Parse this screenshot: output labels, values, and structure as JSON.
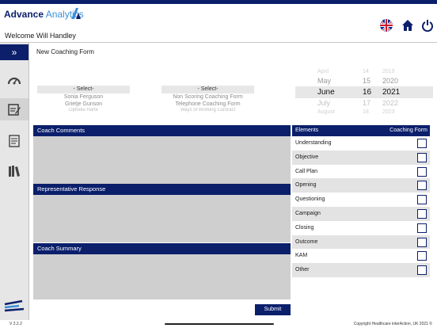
{
  "brand": {
    "name_bold": "Advance",
    "name_light": "Analytics"
  },
  "header": {
    "welcome": "Welcome Will Handley"
  },
  "sidebar": {
    "expand_glyph": "»",
    "items": [
      "dashboard-gauge-icon",
      "coaching-form-icon",
      "notes-icon",
      "library-icon"
    ]
  },
  "form": {
    "title": "New Coaching Form",
    "agent_picker": {
      "selected": "- Select-",
      "options": [
        "Sonia Ferguson",
        "Grietje Gunson",
        "Ophelia Harte"
      ]
    },
    "form_picker": {
      "selected": "- Select-",
      "options": [
        "Non Scoring Coaching Form",
        "Telephone Coaching Form",
        "Ways of Working Contract"
      ]
    },
    "date_picker": {
      "rows": [
        {
          "month": "April",
          "day": "14",
          "year": "2019"
        },
        {
          "month": "May",
          "day": "15",
          "year": "2020"
        },
        {
          "month": "June",
          "day": "16",
          "year": "2021"
        },
        {
          "month": "July",
          "day": "17",
          "year": "2022"
        },
        {
          "month": "August",
          "day": "18",
          "year": "2023"
        }
      ]
    }
  },
  "panels": {
    "coach_comments": "Coach Comments",
    "representative_response": "Representative Response",
    "coach_summary": "Coach Summary"
  },
  "elements": {
    "header_left": "Elements",
    "header_right": "Coaching Form",
    "rows": [
      "Understanding",
      "Objective",
      "Call Plan",
      "Opening",
      "Questioning",
      "Campaign",
      "Closing",
      "Outcome",
      "KAM",
      "Other"
    ]
  },
  "submit_label": "Submit",
  "footer": {
    "version": "V 2.2.2",
    "copyright": "Copyright Healthcare interAction, UK 2021 ©"
  },
  "colors": {
    "brand_navy": "#0b1f6b",
    "brand_blue": "#3a8fd8",
    "panel_grey": "#cfcfcf"
  }
}
